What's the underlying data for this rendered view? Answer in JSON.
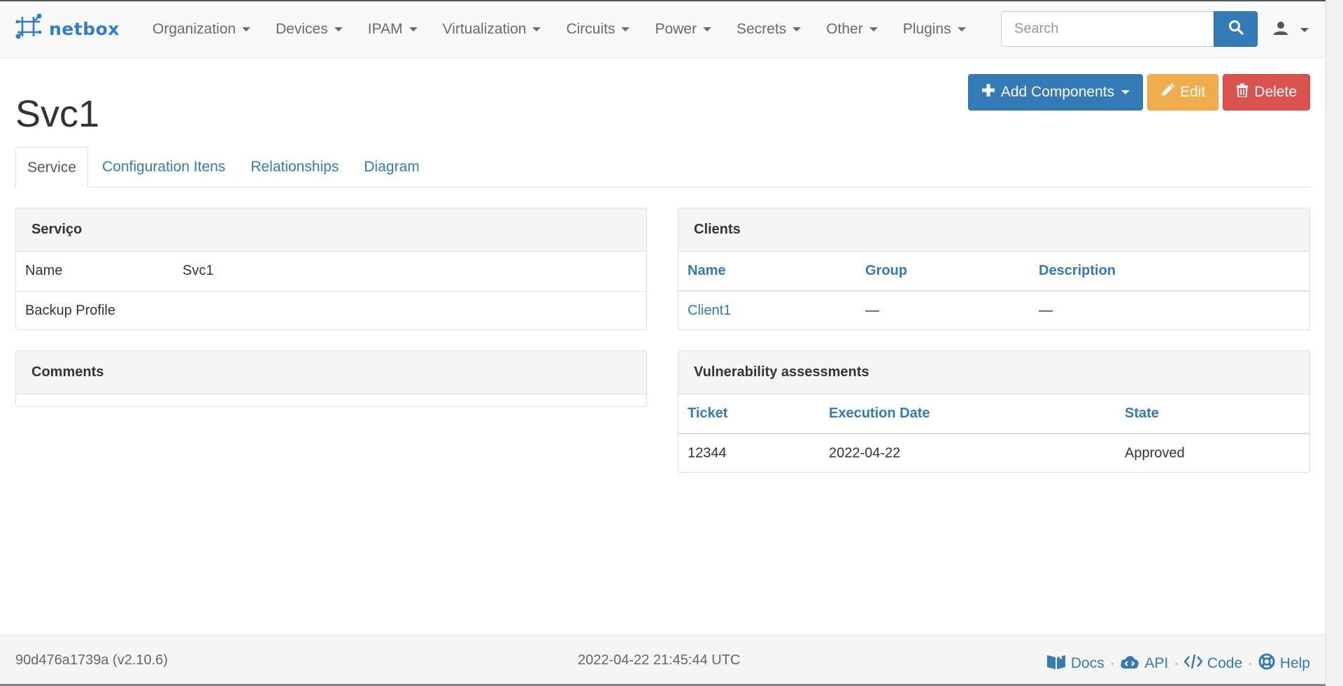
{
  "brand": {
    "name": "netbox"
  },
  "nav": {
    "items": [
      {
        "label": "Organization"
      },
      {
        "label": "Devices"
      },
      {
        "label": "IPAM"
      },
      {
        "label": "Virtualization"
      },
      {
        "label": "Circuits"
      },
      {
        "label": "Power"
      },
      {
        "label": "Secrets"
      },
      {
        "label": "Other"
      },
      {
        "label": "Plugins"
      }
    ],
    "search_placeholder": "Search"
  },
  "page": {
    "title": "Svc1",
    "actions": {
      "add_components": "Add Components",
      "edit": "Edit",
      "delete": "Delete"
    },
    "tabs": [
      {
        "label": "Service",
        "active": true
      },
      {
        "label": "Configuration Itens"
      },
      {
        "label": "Relationships"
      },
      {
        "label": "Diagram"
      }
    ]
  },
  "servico_panel": {
    "title": "Serviço",
    "rows": [
      {
        "key": "Name",
        "value": "Svc1"
      },
      {
        "key": "Backup Profile",
        "value": ""
      }
    ]
  },
  "comments_panel": {
    "title": "Comments"
  },
  "clients_panel": {
    "title": "Clients",
    "columns": [
      "Name",
      "Group",
      "Description"
    ],
    "rows": [
      {
        "name": "Client1",
        "group": "—",
        "description": "—"
      }
    ]
  },
  "vuln_panel": {
    "title": "Vulnerability assessments",
    "columns": [
      "Ticket",
      "Execution Date",
      "State"
    ],
    "rows": [
      {
        "ticket": "12344",
        "execution_date": "2022-04-22",
        "state": "Approved"
      }
    ]
  },
  "footer": {
    "version": "90d476a1739a (v2.10.6)",
    "timestamp": "2022-04-22 21:45:44 UTC",
    "links": {
      "docs": "Docs",
      "api": "API",
      "code": "Code",
      "help": "Help",
      "separator": "·"
    }
  },
  "colors": {
    "brand": "#2d7dd2",
    "primary": "#337ab7",
    "warning": "#f0ad4e",
    "danger": "#d9534f"
  }
}
